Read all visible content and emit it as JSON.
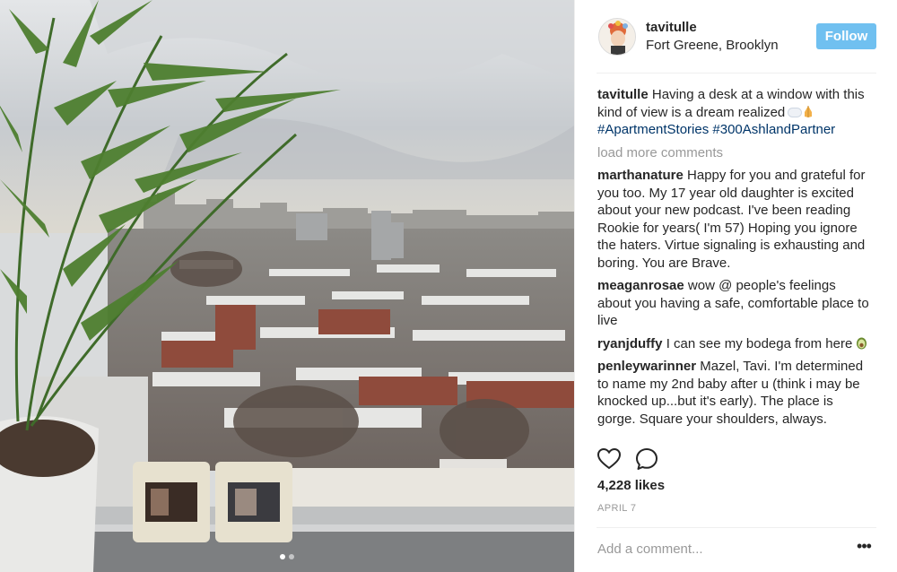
{
  "post": {
    "username": "tavitulle",
    "location": "Fort Greene, Brooklyn",
    "follow_label": "Follow",
    "avatar_icon": "avatar-illustration",
    "colors": {
      "follow_button": "#70c0f0",
      "hashtag": "#003569",
      "muted": "#999999",
      "text": "#262626"
    }
  },
  "caption": {
    "username": "tavitulle",
    "text": "Having a desk at a window with this kind of view is a dream realized",
    "emoji": [
      "cloud",
      "folded-hands"
    ],
    "hashtags": [
      "#ApartmentStories",
      "#300AshlandPartner"
    ]
  },
  "load_more_label": "load more comments",
  "comments": [
    {
      "username": "marthanature",
      "text": "Happy for you and grateful for you too. My 17 year old daughter is excited about your new podcast. I've been reading Rookie for years( I'm 57) Hoping you ignore the haters. Virtue signaling is exhausting and boring. You are Brave."
    },
    {
      "username": "meaganrosae",
      "text": "wow @ people's feelings about you having a safe, comfortable place to live"
    },
    {
      "username": "ryanjduffy",
      "text": "I can see my bodega from here"
    },
    {
      "username": "penleywarinner",
      "text": "Mazel, Tavi. I'm determined to name my 2nd baby after u (think i may be knocked up...but it's early). The place is gorge. Square your shoulders, always."
    }
  ],
  "likes": "4,228 likes",
  "date": "APRIL 7",
  "add_comment_placeholder": "Add a comment...",
  "more_options_label": "•••",
  "carousel": {
    "count": 2,
    "active": 1
  },
  "icons": {
    "like": "heart-icon",
    "comment": "comment-bubble-icon",
    "options": "more-options-icon"
  }
}
